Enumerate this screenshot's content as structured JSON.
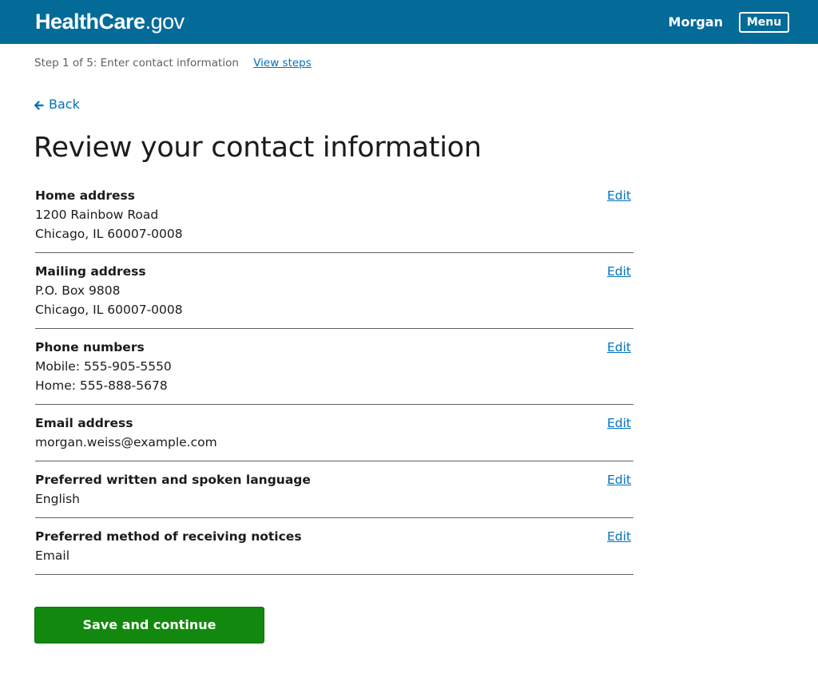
{
  "header": {
    "logo_main": "HealthCare",
    "logo_tld": ".gov",
    "user_name": "Morgan",
    "menu_label": "Menu"
  },
  "stepbar": {
    "step_text": "Step 1 of 5: Enter contact information",
    "view_steps_label": "View steps"
  },
  "back_label": "Back",
  "page_title": "Review your contact information",
  "sections": [
    {
      "label": "Home address",
      "lines": [
        "1200 Rainbow Road",
        "Chicago, IL 60007-0008"
      ],
      "edit_label": "Edit"
    },
    {
      "label": "Mailing address",
      "lines": [
        "P.O. Box 9808",
        "Chicago, IL 60007-0008"
      ],
      "edit_label": "Edit"
    },
    {
      "label": "Phone numbers",
      "lines": [
        "Mobile: 555-905-5550",
        "Home: 555-888-5678"
      ],
      "edit_label": "Edit"
    },
    {
      "label": "Email address",
      "lines": [
        "morgan.weiss@example.com"
      ],
      "edit_label": "Edit"
    },
    {
      "label": "Preferred written and spoken language",
      "lines": [
        "English"
      ],
      "edit_label": "Edit"
    },
    {
      "label": "Preferred method of receiving notices",
      "lines": [
        "Email"
      ],
      "edit_label": "Edit"
    }
  ],
  "save_button_label": "Save and continue",
  "colors": {
    "header_bg": "#046b99",
    "link": "#0071bc",
    "primary_button": "#12890e",
    "text": "#1b1b1b",
    "muted_text": "#5b616b"
  },
  "icons": {
    "back": "arrow-left-icon"
  }
}
